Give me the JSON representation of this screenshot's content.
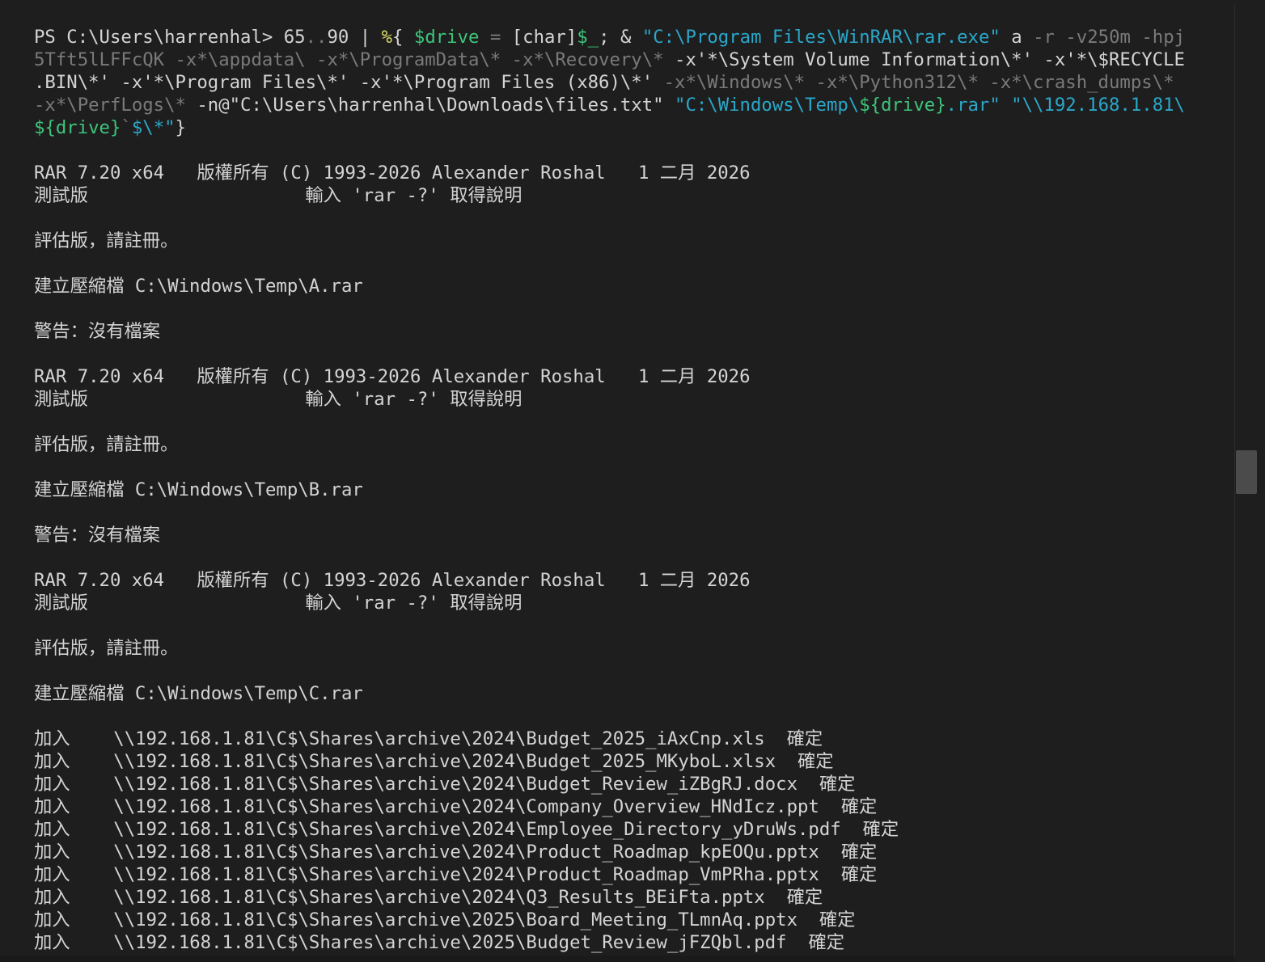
{
  "colors": {
    "background": "#1e1e1e",
    "text": "#d4d4d4",
    "muted": "#7a7a7a",
    "string_cyan": "#2aa7c9",
    "variable_green": "#3ec47a",
    "operator_yellow": "#dcdc66"
  },
  "terminal": {
    "lines": [
      [
        {
          "t": "PS C:\\Users\\harrenhal> 65",
          "c": "default"
        },
        {
          "t": "..",
          "c": "muted"
        },
        {
          "t": "90 | ",
          "c": "default"
        },
        {
          "t": "%",
          "c": "yellow"
        },
        {
          "t": "{ ",
          "c": "default"
        },
        {
          "t": "$drive",
          "c": "green"
        },
        {
          "t": " = ",
          "c": "muted"
        },
        {
          "t": "[char]",
          "c": "default"
        },
        {
          "t": "$_",
          "c": "green"
        },
        {
          "t": "; & ",
          "c": "default"
        },
        {
          "t": "\"C:\\Program Files\\WinRAR\\rar.exe\"",
          "c": "cyan"
        },
        {
          "t": " a ",
          "c": "default"
        },
        {
          "t": "-r -v250m -hpj",
          "c": "muted"
        }
      ],
      [
        {
          "t": "5Tft5lLFFcQK -x*\\appdata\\ -x*\\ProgramData\\* -x*\\Recovery\\* ",
          "c": "muted"
        },
        {
          "t": "-x'*\\System Volume Information\\*' -x'*\\$RECYCLE",
          "c": "default"
        }
      ],
      [
        {
          "t": ".BIN\\*' -x'*\\Program Files\\*' -x'*\\Program Files (x86)\\*' ",
          "c": "default"
        },
        {
          "t": "-x*\\Windows\\* -x*\\Python312\\* -x*\\crash_dumps\\*",
          "c": "muted"
        }
      ],
      [
        {
          "t": "-x*\\PerfLogs\\* ",
          "c": "muted"
        },
        {
          "t": "-n@\"C:\\Users\\harrenhal\\Downloads\\files.txt\" ",
          "c": "default"
        },
        {
          "t": "\"C:\\Windows\\Temp\\",
          "c": "cyan"
        },
        {
          "t": "${drive}",
          "c": "green"
        },
        {
          "t": ".rar\" \"\\\\192.168.1.81\\",
          "c": "cyan"
        }
      ],
      [
        {
          "t": "${drive}",
          "c": "green"
        },
        {
          "t": "`",
          "c": "muted"
        },
        {
          "t": "$\\*\"",
          "c": "cyan"
        },
        {
          "t": "}",
          "c": "default"
        }
      ],
      [],
      [
        {
          "t": "RAR 7.20 x64   版權所有 (C) 1993-2026 Alexander Roshal   1 二月 2026",
          "c": "default"
        }
      ],
      [
        {
          "t": "測試版                    輸入 'rar -?' 取得說明",
          "c": "default"
        }
      ],
      [],
      [
        {
          "t": "評估版，請註冊。",
          "c": "default"
        }
      ],
      [],
      [
        {
          "t": "建立壓縮檔 C:\\Windows\\Temp\\A.rar",
          "c": "default"
        }
      ],
      [],
      [
        {
          "t": "警告：沒有檔案",
          "c": "default"
        }
      ],
      [],
      [
        {
          "t": "RAR 7.20 x64   版權所有 (C) 1993-2026 Alexander Roshal   1 二月 2026",
          "c": "default"
        }
      ],
      [
        {
          "t": "測試版                    輸入 'rar -?' 取得說明",
          "c": "default"
        }
      ],
      [],
      [
        {
          "t": "評估版，請註冊。",
          "c": "default"
        }
      ],
      [],
      [
        {
          "t": "建立壓縮檔 C:\\Windows\\Temp\\B.rar",
          "c": "default"
        }
      ],
      [],
      [
        {
          "t": "警告：沒有檔案",
          "c": "default"
        }
      ],
      [],
      [
        {
          "t": "RAR 7.20 x64   版權所有 (C) 1993-2026 Alexander Roshal   1 二月 2026",
          "c": "default"
        }
      ],
      [
        {
          "t": "測試版                    輸入 'rar -?' 取得說明",
          "c": "default"
        }
      ],
      [],
      [
        {
          "t": "評估版，請註冊。",
          "c": "default"
        }
      ],
      [],
      [
        {
          "t": "建立壓縮檔 C:\\Windows\\Temp\\C.rar",
          "c": "default"
        }
      ],
      [],
      [
        {
          "t": "加入    \\\\192.168.1.81\\C$\\Shares\\archive\\2024\\Budget_2025_iAxCnp.xls  確定",
          "c": "default"
        }
      ],
      [
        {
          "t": "加入    \\\\192.168.1.81\\C$\\Shares\\archive\\2024\\Budget_2025_MKyboL.xlsx  確定",
          "c": "default"
        }
      ],
      [
        {
          "t": "加入    \\\\192.168.1.81\\C$\\Shares\\archive\\2024\\Budget_Review_iZBgRJ.docx  確定",
          "c": "default"
        }
      ],
      [
        {
          "t": "加入    \\\\192.168.1.81\\C$\\Shares\\archive\\2024\\Company_Overview_HNdIcz.ppt  確定",
          "c": "default"
        }
      ],
      [
        {
          "t": "加入    \\\\192.168.1.81\\C$\\Shares\\archive\\2024\\Employee_Directory_yDruWs.pdf  確定",
          "c": "default"
        }
      ],
      [
        {
          "t": "加入    \\\\192.168.1.81\\C$\\Shares\\archive\\2024\\Product_Roadmap_kpEOQu.pptx  確定",
          "c": "default"
        }
      ],
      [
        {
          "t": "加入    \\\\192.168.1.81\\C$\\Shares\\archive\\2024\\Product_Roadmap_VmPRha.pptx  確定",
          "c": "default"
        }
      ],
      [
        {
          "t": "加入    \\\\192.168.1.81\\C$\\Shares\\archive\\2024\\Q3_Results_BEiFta.pptx  確定",
          "c": "default"
        }
      ],
      [
        {
          "t": "加入    \\\\192.168.1.81\\C$\\Shares\\archive\\2025\\Board_Meeting_TLmnAq.pptx  確定",
          "c": "default"
        }
      ],
      [
        {
          "t": "加入    \\\\192.168.1.81\\C$\\Shares\\archive\\2025\\Budget_Review_jFZQbl.pdf  確定",
          "c": "default"
        }
      ]
    ]
  }
}
